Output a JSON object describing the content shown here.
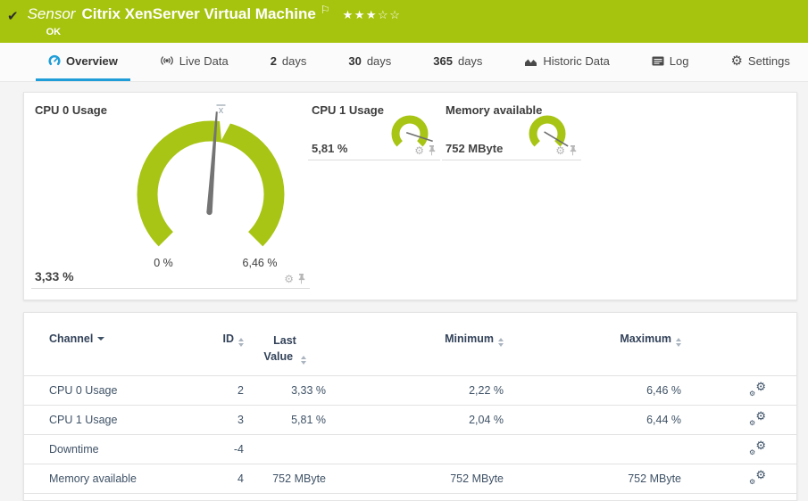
{
  "header": {
    "kind_label": "Sensor",
    "title": "Citrix XenServer Virtual Machine",
    "status": "OK",
    "stars_filled": "★★★",
    "stars_empty": "☆☆",
    "rating": "3 of 5",
    "check_glyph": "✔",
    "flag_glyph": "⚐"
  },
  "tabs": [
    {
      "label": "Overview",
      "icon": "gauge-icon",
      "active": true
    },
    {
      "label": "Live Data",
      "icon": "live-data-icon"
    },
    {
      "num": "2",
      "label": "days"
    },
    {
      "num": "30",
      "label": "days"
    },
    {
      "num": "365",
      "label": "days"
    },
    {
      "label": "Historic Data",
      "icon": "historic-data-icon"
    },
    {
      "label": "Log",
      "icon": "log-icon"
    },
    {
      "label": "Settings",
      "icon": "settings-gear-icon",
      "glyph": "⚙"
    }
  ],
  "gauges": [
    {
      "title": "CPU 0 Usage",
      "value_label": "3,33 %",
      "value": 3.33,
      "scale_min_label": "0 %",
      "scale_max_label": "6,46 %",
      "scale_min": 0,
      "scale_max": 6.46,
      "mean_marker": "x"
    },
    {
      "title": "CPU 1 Usage",
      "value_label": "5,81 %",
      "value": 5.81
    },
    {
      "title": "Memory available",
      "value_label": "752 MByte",
      "value": 752
    }
  ],
  "tile_icons": {
    "gear_glyph": "⚙"
  },
  "table": {
    "headers": {
      "channel": "Channel",
      "id": "ID",
      "last_value": "Last Value",
      "minimum": "Minimum",
      "maximum": "Maximum"
    },
    "rows": [
      {
        "channel": "CPU 0 Usage",
        "id": "2",
        "last_value": "3,33 %",
        "minimum": "2,22 %",
        "maximum": "6,46 %"
      },
      {
        "channel": "CPU 1 Usage",
        "id": "3",
        "last_value": "5,81 %",
        "minimum": "2,04 %",
        "maximum": "6,44 %"
      },
      {
        "channel": "Downtime",
        "id": "-4",
        "last_value": "",
        "minimum": "",
        "maximum": ""
      },
      {
        "channel": "Memory available",
        "id": "4",
        "last_value": "752 MByte",
        "minimum": "752 MByte",
        "maximum": "752 MByte"
      }
    ],
    "settings_gear_glyph": "⚙"
  },
  "colors": {
    "status_ok_green": "#a6c40d",
    "gauge_green": "#a8c414",
    "accent_blue": "#1e9dd8",
    "needle_gray": "#747474"
  }
}
